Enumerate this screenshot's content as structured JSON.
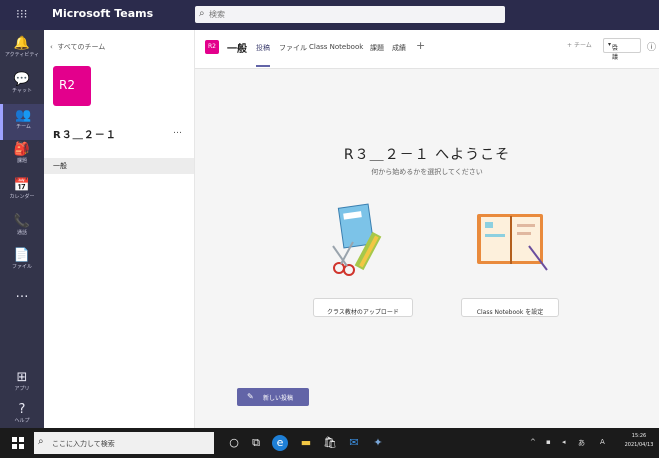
{
  "app": {
    "title": "Microsoft Teams"
  },
  "search": {
    "placeholder": "検索"
  },
  "rail": [
    {
      "label": "アクティビティ",
      "glyph": "🔔"
    },
    {
      "label": "チャット",
      "glyph": "💬"
    },
    {
      "label": "チーム",
      "glyph": "👥"
    },
    {
      "label": "課題",
      "glyph": "🎒"
    },
    {
      "label": "カレンダー",
      "glyph": "📅"
    },
    {
      "label": "通話",
      "glyph": "📞"
    },
    {
      "label": "ファイル",
      "glyph": "📄"
    },
    {
      "label": "",
      "glyph": "…"
    },
    {
      "label": "アプリ",
      "glyph": "⊞"
    },
    {
      "label": "ヘルプ",
      "glyph": "?"
    }
  ],
  "team": {
    "back_label": "すべてのチーム",
    "avatar_text": "R2",
    "name": "R３＿２－１",
    "more": "…",
    "channels": [
      "一般"
    ]
  },
  "channel_header": {
    "avatar_text": "R2",
    "name": "一般",
    "tabs": [
      "投稿",
      "ファイル",
      "Class Notebook",
      "課題",
      "成績"
    ],
    "add_tab": "+",
    "team_btn": "チーム",
    "meet_btn": "会議",
    "info": "ⓘ"
  },
  "welcome": {
    "title": "R３＿２－１ へようこそ",
    "subtitle": "何から始めるかを選択してください",
    "upload_btn": "クラス教材のアップロード",
    "notebook_btn": "Class Notebook を設定"
  },
  "compose": {
    "new_post": "新しい投稿",
    "icon": "✎"
  },
  "taskbar": {
    "search_placeholder": "ここに入力して検索",
    "clock_time": "15:26",
    "clock_date": "2021/04/13"
  },
  "colors": {
    "brand": "#6264a7",
    "tile": "#e3008c",
    "topbar": "#2b2b4c",
    "rail": "#33344a"
  }
}
